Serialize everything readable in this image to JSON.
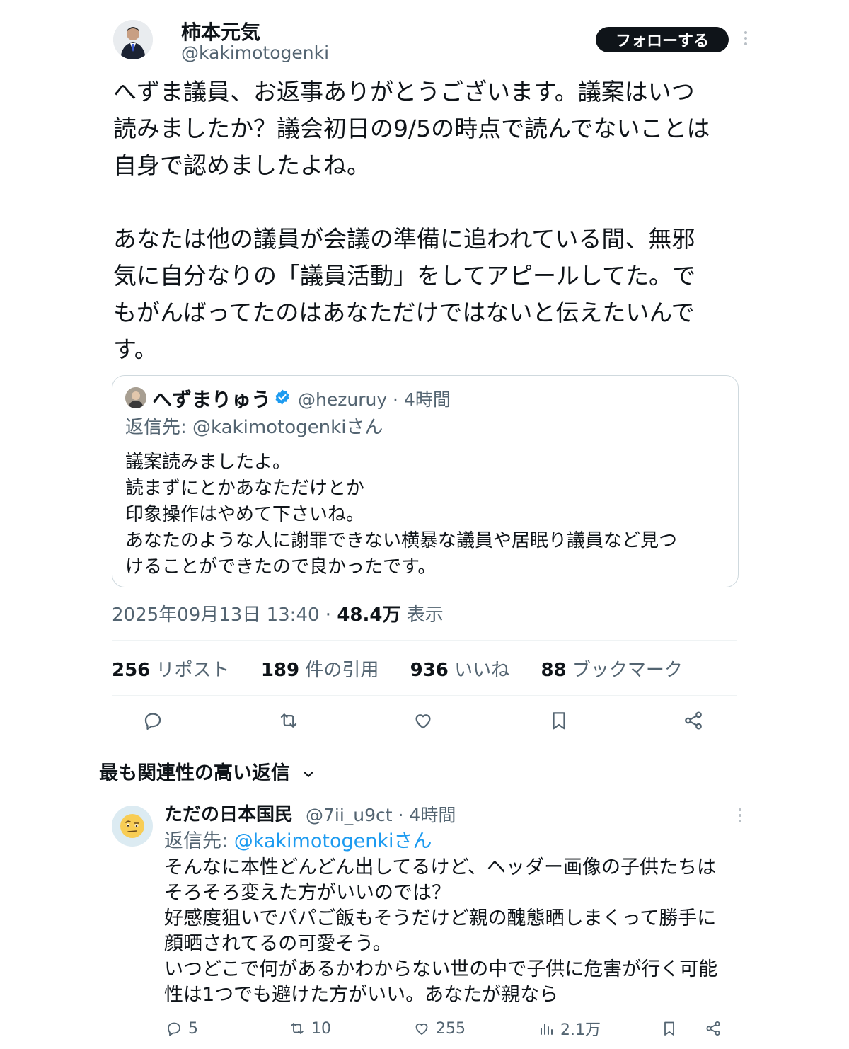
{
  "tweet": {
    "author_name": "柿本元気",
    "author_handle": "@kakimotogenki",
    "follow_label": "フォローする",
    "text": "へずま議員、お返事ありがとうございます。議案はいつ\n読みましたか？議会初日の9/5の時点で読んでないことは\n自身で認めましたよね。\n\nあなたは他の議員が会議の準備に追われている間、無邪\n気に自分なりの「議員活動」をしてアピールしてた。で\nもがんばってたのはあなただけではないと伝えたいんで\nす。",
    "timestamp": "2025年09月13日 13:40 · ",
    "views_count": "48.4万",
    "views_label": " 表示"
  },
  "quote": {
    "author_name": "へずまりゅう",
    "handle_time": "@hezuruy · 4時間",
    "reply_to": "返信先: @kakimotogenkiさん",
    "text": "議案読みましたよ。\n読まずにとかあなただけとか\n印象操作はやめて下さいね。\nあなたのような人に謝罪できない横暴な議員や居眠り議員など見つ\nけることができたので良かったです。"
  },
  "stats": [
    {
      "count": "256",
      "label": " リポスト"
    },
    {
      "count": "189",
      "label": " 件の引用"
    },
    {
      "count": "936",
      "label": " いいね"
    },
    {
      "count": "88",
      "label": " ブックマーク"
    }
  ],
  "replies_heading": "最も関連性の高い返信",
  "reply": {
    "author_name": "ただの日本国民",
    "handle_time": "@7ii_u9ct · 4時間",
    "reply_to_prefix": "返信先: ",
    "reply_to_mention": "@kakimotogenkiさん",
    "text": "そんなに本性どんどん出してるけど、ヘッダー画像の子供たちは\nそろそろ変えた方がいいのでは？\n好感度狙いでパパご飯もそうだけど親の醜態晒しまくって勝手に\n顔晒されてるの可愛そう。\nいつどこで何があるかわからない世の中で子供に危害が行く可能\n性は1つでも避けた方がいい。あなたが親なら",
    "replies": "5",
    "reposts": "10",
    "likes": "255",
    "views": "2.1万"
  },
  "colors": {
    "text": "#0f1419",
    "secondary": "#536471",
    "accent": "#1d9bf0",
    "border": "#cfd9de"
  },
  "icons": [
    "reply-icon",
    "repost-icon",
    "like-icon",
    "bookmark-icon",
    "share-icon",
    "verified-badge-icon",
    "more-icon",
    "chevron-down-icon",
    "views-icon"
  ]
}
